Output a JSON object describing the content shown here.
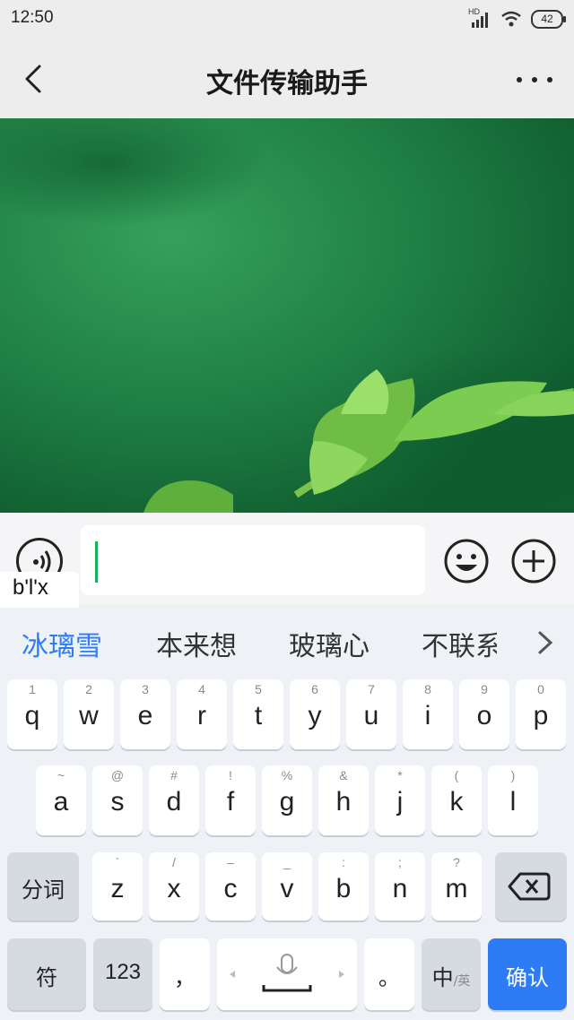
{
  "status_bar": {
    "time": "12:50",
    "network": "HD",
    "battery": "42"
  },
  "header": {
    "title": "文件传输助手"
  },
  "input": {
    "value": "",
    "pinyin": "b'l'x"
  },
  "candidates": [
    "冰璃雪",
    "本来想",
    "玻璃心",
    "不联系"
  ],
  "keyboard": {
    "row1": [
      {
        "k": "q",
        "s": "1"
      },
      {
        "k": "w",
        "s": "2"
      },
      {
        "k": "e",
        "s": "3"
      },
      {
        "k": "r",
        "s": "4"
      },
      {
        "k": "t",
        "s": "5"
      },
      {
        "k": "y",
        "s": "6"
      },
      {
        "k": "u",
        "s": "7"
      },
      {
        "k": "i",
        "s": "8"
      },
      {
        "k": "o",
        "s": "9"
      },
      {
        "k": "p",
        "s": "0"
      }
    ],
    "row2": [
      {
        "k": "a",
        "s": "~"
      },
      {
        "k": "s",
        "s": "@"
      },
      {
        "k": "d",
        "s": "#"
      },
      {
        "k": "f",
        "s": "!"
      },
      {
        "k": "g",
        "s": "%"
      },
      {
        "k": "h",
        "s": "&"
      },
      {
        "k": "j",
        "s": "*"
      },
      {
        "k": "k",
        "s": "("
      },
      {
        "k": "l",
        "s": ")"
      }
    ],
    "row3": [
      {
        "k": "z",
        "s": "`"
      },
      {
        "k": "x",
        "s": "/"
      },
      {
        "k": "c",
        "s": "–"
      },
      {
        "k": "v",
        "s": "_"
      },
      {
        "k": "b",
        "s": ":"
      },
      {
        "k": "n",
        "s": ";"
      },
      {
        "k": "m",
        "s": "?"
      }
    ],
    "segment": "分词",
    "symbols": "符",
    "numbers": "123",
    "comma": "，",
    "period": "。",
    "lang_main": "中",
    "lang_alt": "/英",
    "confirm": "确认"
  },
  "colors": {
    "accent_green": "#1aad5b",
    "candidate_blue": "#2d7cf6",
    "confirm_blue": "#2d7cf6"
  }
}
